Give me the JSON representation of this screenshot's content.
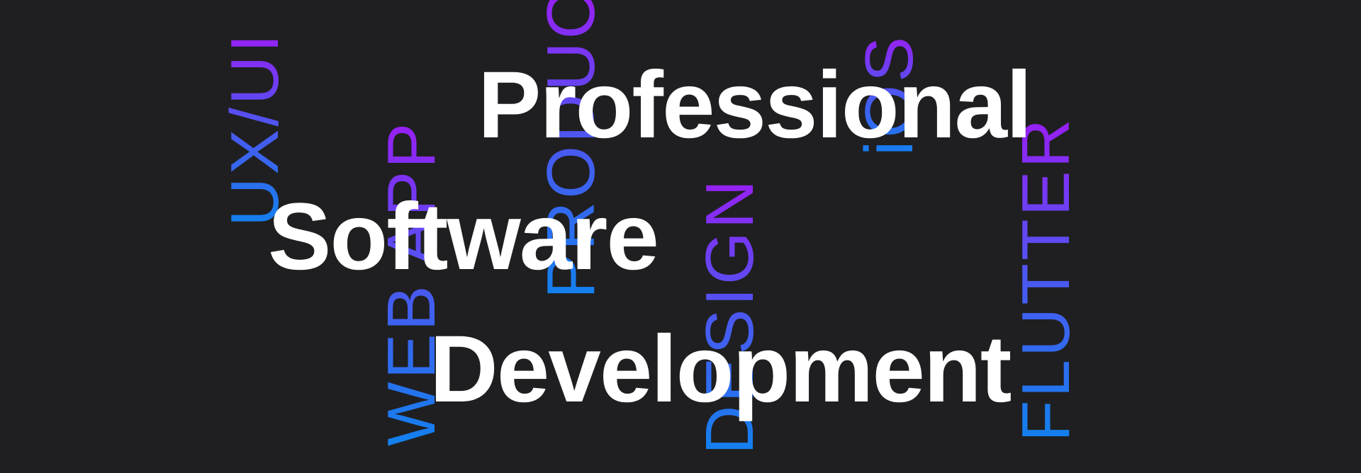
{
  "background_color": "#1f1f21",
  "gradient": {
    "start": "#1281ee",
    "middle": "#4b58f0",
    "end": "#9a1ef5"
  },
  "vertical_words": {
    "uxui": "UX/UI",
    "webapp": "WEB APP",
    "product": "PRODUC",
    "design": "DESIGN",
    "ios": "iOS",
    "flutter": "FLUTTER"
  },
  "headline": {
    "line1": "Professional",
    "line2": "Software",
    "line3": "Development"
  }
}
